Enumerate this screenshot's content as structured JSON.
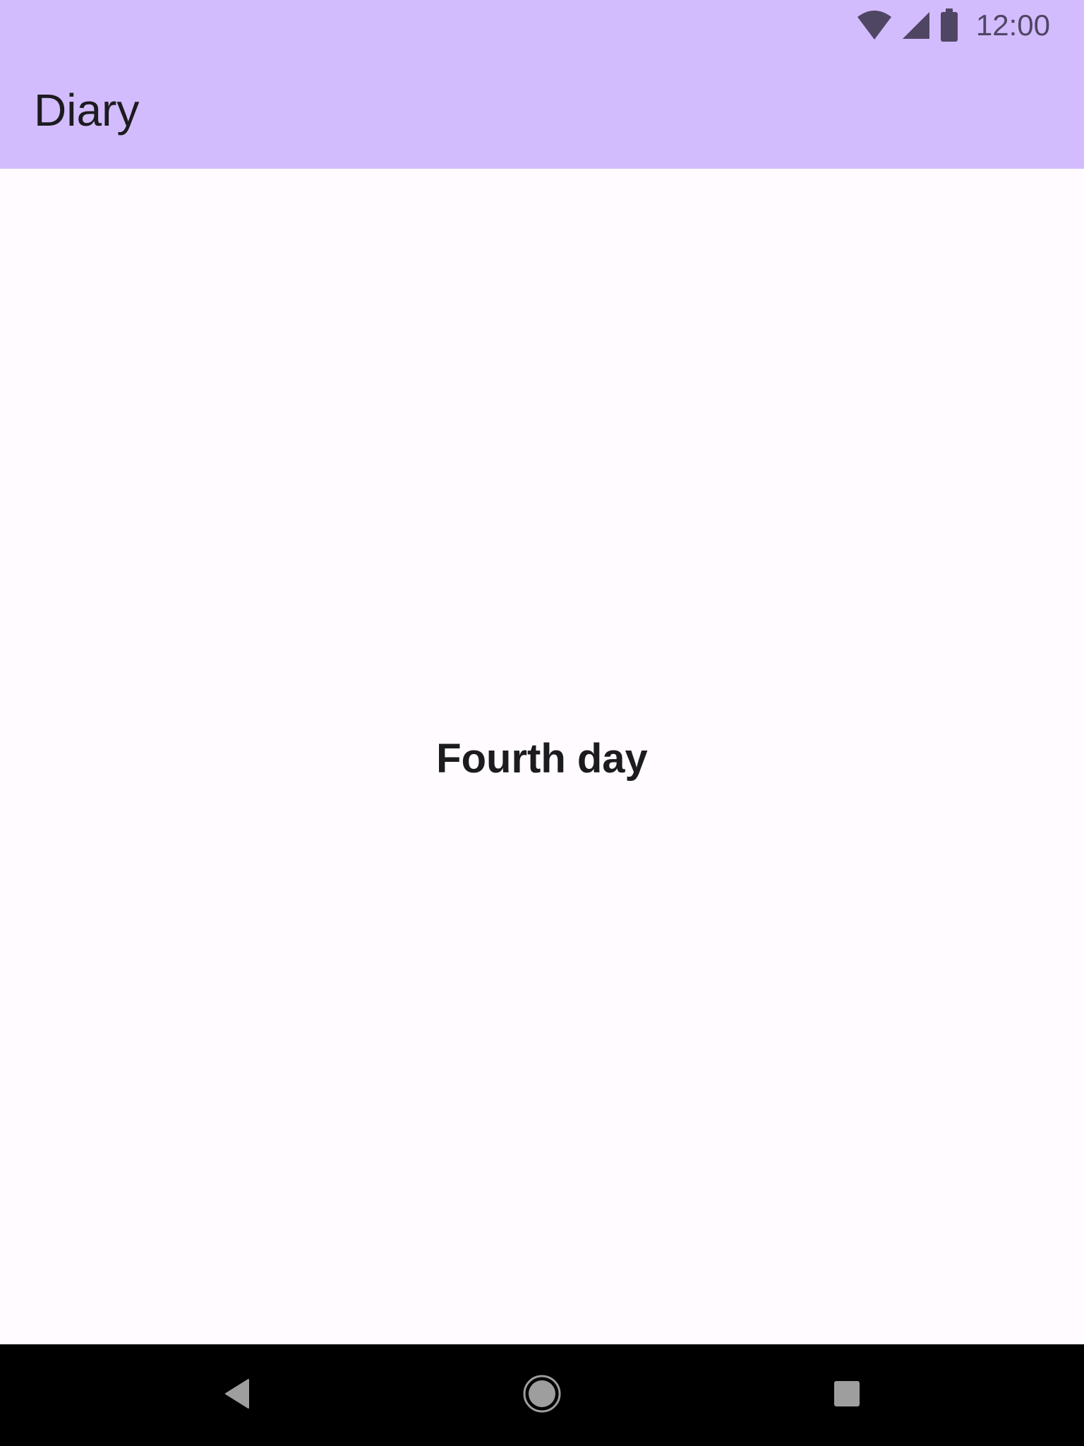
{
  "status_bar": {
    "time": "12:00",
    "icons": [
      "wifi-icon",
      "cellular-signal-icon",
      "battery-icon"
    ]
  },
  "app_bar": {
    "title": "Diary"
  },
  "content": {
    "entry_text": "Fourth day"
  },
  "nav_bar": {
    "buttons": [
      "back",
      "home",
      "recents"
    ]
  },
  "colors": {
    "app_bar_bg": "#d3bcfd",
    "background": "#fffbfe",
    "text": "#1c1b1f",
    "status_icons": "#4f4664",
    "nav_bar_bg": "#000000"
  }
}
